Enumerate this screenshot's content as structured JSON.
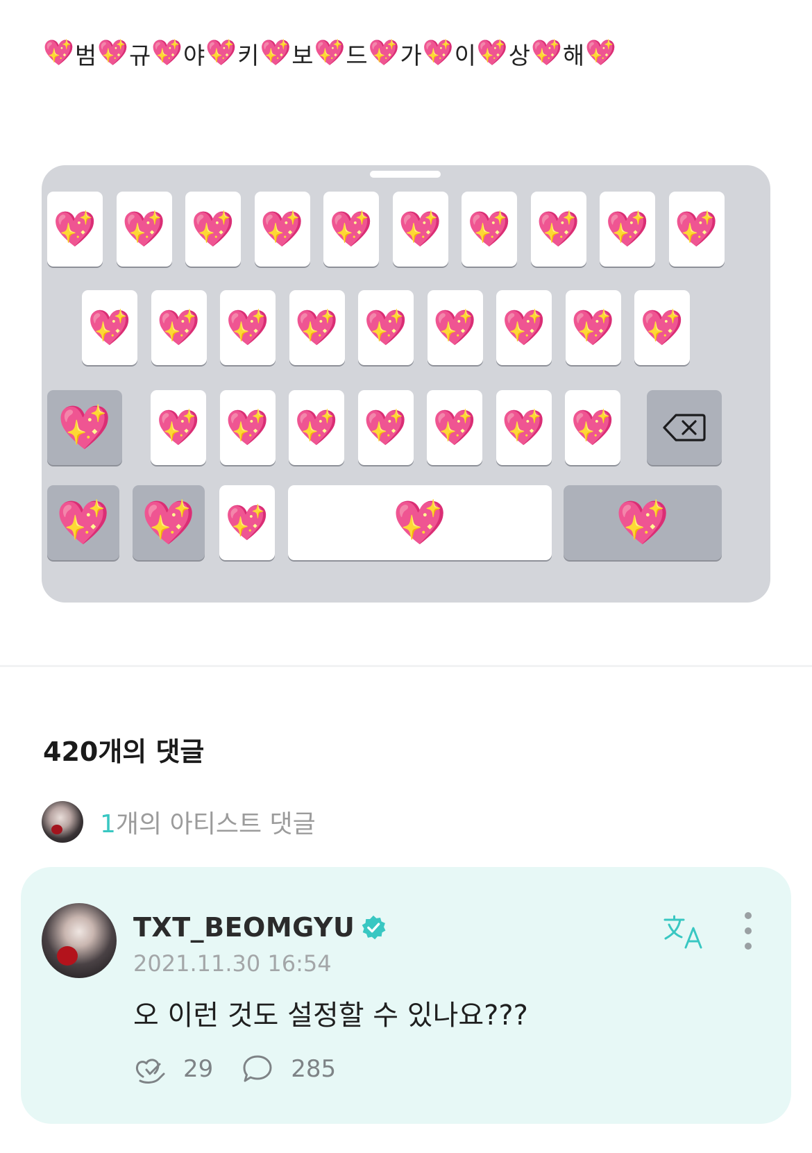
{
  "post": {
    "syllables": [
      "범",
      "규",
      "야",
      "키",
      "보",
      "드",
      "가",
      "이",
      "상",
      "해"
    ],
    "emoji": "💖"
  },
  "keyboard_image": {
    "key_emoji": "💖",
    "background_color": "#d3d5da",
    "delete_icon": "backspace-icon"
  },
  "comments": {
    "count_label": "420개의 댓글",
    "artist_count": "1",
    "artist_label": "개의 아티스트 댓글"
  },
  "comment": {
    "author": "TXT_BEOMGYU",
    "verified_icon": "verified-badge-icon",
    "timestamp": "2021.11.30 16:54",
    "body": "오 이런 것도 설정할 수 있나요???",
    "likes": "29",
    "replies": "285",
    "accent_color": "#39c7c2",
    "card_color": "#e7f8f6"
  },
  "icons": {
    "translate": "translate-icon",
    "more": "more-vertical-icon",
    "like": "like-icon",
    "reply": "reply-bubble-icon"
  }
}
